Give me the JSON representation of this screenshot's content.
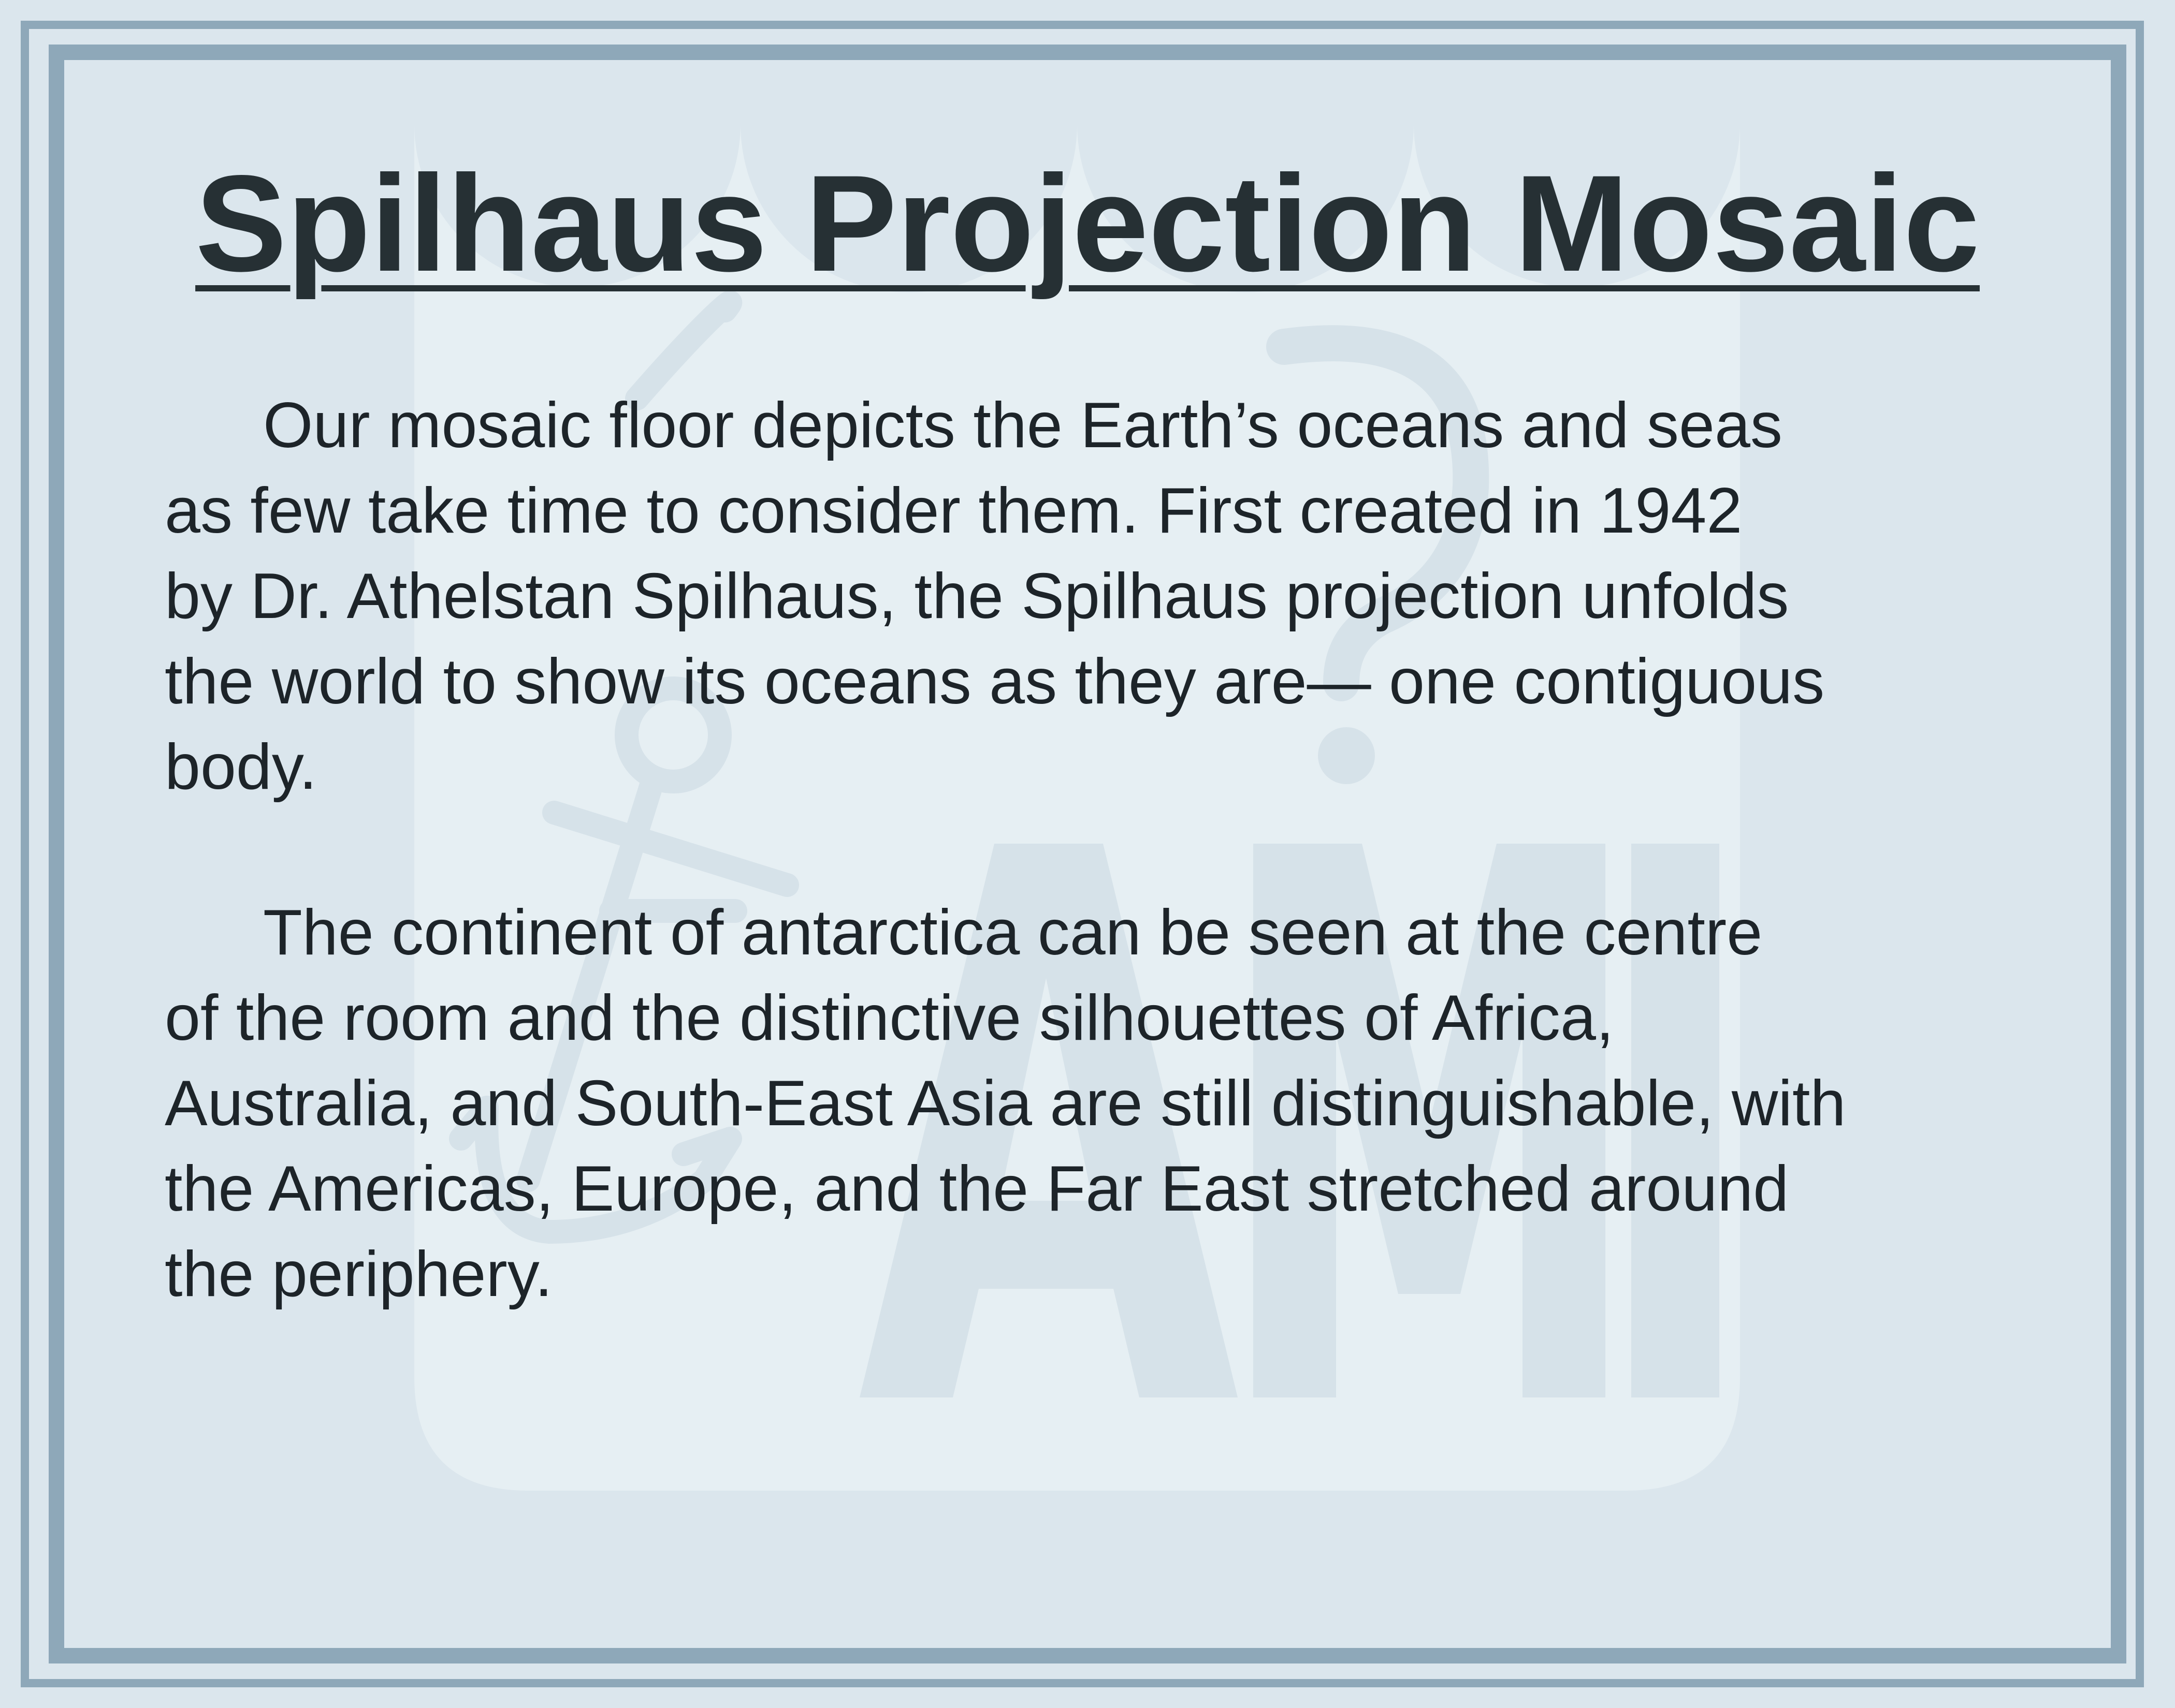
{
  "sign": {
    "title": "Spilhaus Projection Mosaic",
    "paragraphs": [
      "Our mosaic floor depicts the Earth’s oceans and seas\nas few take time to consider them. First created in 1942\nby Dr. Athelstan Spilhaus, the Spilhaus projection unfolds\nthe world to show its oceans as they are— one contiguous\nbody.",
      "The continent of antarctica can be seen at the centre\nof the room and the distinctive silhouettes of Africa,\nAustralia, and South-East Asia are still distinguishable, with\nthe Americas, Europe, and the Far East stretched around\nthe periphery."
    ]
  },
  "watermark": {
    "text": "AMI",
    "icon": "anchor-shield-logo-icon"
  },
  "colors": {
    "background": "#dbe6ed",
    "frame": "#8ea8b9",
    "watermark": "#e6eff3",
    "title_text": "#263034",
    "body_text": "#1d2429"
  }
}
